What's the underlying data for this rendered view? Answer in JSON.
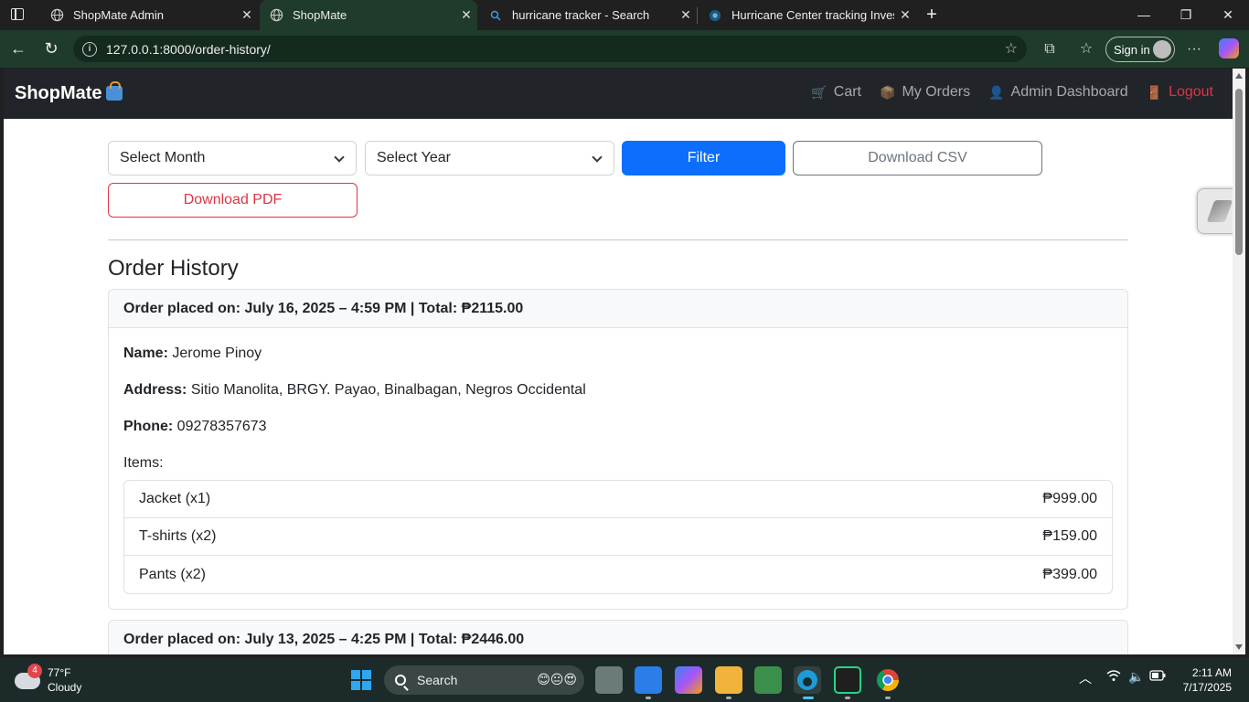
{
  "browser": {
    "tabs": [
      {
        "title": "ShopMate Admin",
        "icon": "globe-icon"
      },
      {
        "title": "ShopMate",
        "icon": "globe-icon",
        "active": true
      },
      {
        "title": "hurricane tracker - Search",
        "icon": "search-icon"
      },
      {
        "title": "Hurricane Center tracking Invest 9",
        "icon": "site-icon"
      }
    ],
    "url": "127.0.0.1:8000/order-history/",
    "signin_label": "Sign in",
    "accent": "#1e3b2b"
  },
  "navbar": {
    "brand": "ShopMate",
    "links": [
      {
        "label": "Cart",
        "icon": "cart-icon"
      },
      {
        "label": "My Orders",
        "icon": "package-icon"
      },
      {
        "label": "Admin Dashboard",
        "icon": "person-icon"
      },
      {
        "label": "Logout",
        "icon": "door-icon",
        "color": "#dc3545"
      }
    ]
  },
  "filters": {
    "month_placeholder": "Select Month",
    "year_placeholder": "Select Year",
    "filter_label": "Filter",
    "csv_label": "Download CSV",
    "pdf_label": "Download PDF"
  },
  "page": {
    "title": "Order History"
  },
  "orders": [
    {
      "header": "Order placed on: July 16, 2025 – 4:59 PM | Total: ₱2115.00",
      "name_label": "Name:",
      "name": "Jerome Pinoy",
      "address_label": "Address:",
      "address": "Sitio Manolita, BRGY. Payao, Binalbagan, Negros Occidental",
      "phone_label": "Phone:",
      "phone": "09278357673",
      "items_label": "Items:",
      "items": [
        {
          "name": "Jacket (x1)",
          "price": "₱999.00"
        },
        {
          "name": "T-shirts (x2)",
          "price": "₱159.00"
        },
        {
          "name": "Pants (x2)",
          "price": "₱399.00"
        }
      ]
    },
    {
      "header": "Order placed on: July 13, 2025 – 4:25 PM | Total: ₱2446.00"
    }
  ],
  "taskbar": {
    "weather_temp": "77°F",
    "weather_desc": "Cloudy",
    "weather_badge": "4",
    "search_label": "Search",
    "time": "2:11 AM",
    "date": "7/17/2025"
  },
  "colors": {
    "primary": "#0d6efd",
    "danger": "#dc3545",
    "secondary": "#6c757d",
    "navbar": "#212529"
  }
}
